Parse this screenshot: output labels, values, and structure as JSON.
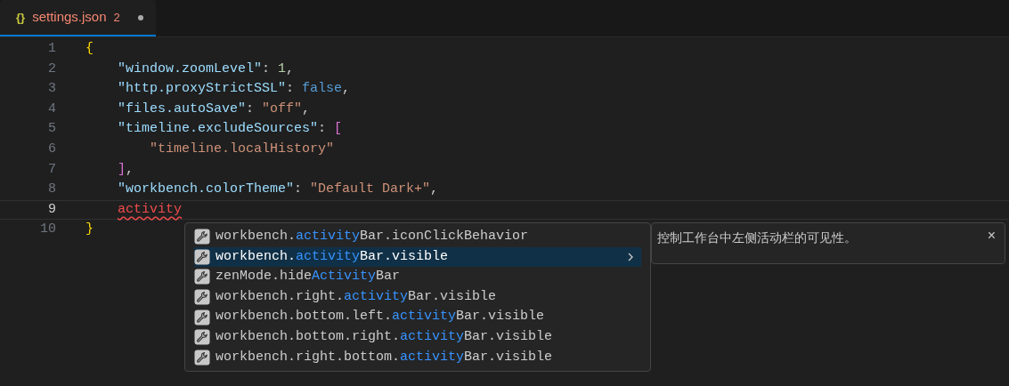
{
  "tab": {
    "icon": "{}",
    "title": "settings.json",
    "problems": "2",
    "dirty": true,
    "selected": true
  },
  "lines": [
    {
      "number": "1",
      "kind": "root",
      "current": false,
      "tokens": [
        {
          "kind": "brace",
          "text": "{"
        }
      ]
    },
    {
      "number": "2",
      "kind": "member",
      "current": false,
      "tokens": [
        {
          "kind": "key",
          "text": "\"window.zoomLevel\""
        },
        {
          "kind": "punct",
          "text": ": "
        },
        {
          "kind": "number",
          "text": "1"
        },
        {
          "kind": "punct",
          "text": ","
        }
      ]
    },
    {
      "number": "3",
      "kind": "member",
      "current": false,
      "tokens": [
        {
          "kind": "key",
          "text": "\"http.proxyStrictSSL\""
        },
        {
          "kind": "punct",
          "text": ": "
        },
        {
          "kind": "bool",
          "text": "false"
        },
        {
          "kind": "punct",
          "text": ","
        }
      ]
    },
    {
      "number": "4",
      "kind": "member",
      "current": false,
      "tokens": [
        {
          "kind": "key",
          "text": "\"files.autoSave\""
        },
        {
          "kind": "punct",
          "text": ": "
        },
        {
          "kind": "string",
          "text": "\"off\""
        },
        {
          "kind": "punct",
          "text": ","
        }
      ]
    },
    {
      "number": "5",
      "kind": "member",
      "current": false,
      "tokens": [
        {
          "kind": "key",
          "text": "\"timeline.excludeSources\""
        },
        {
          "kind": "punct",
          "text": ": "
        },
        {
          "kind": "bracket",
          "text": "["
        }
      ]
    },
    {
      "number": "6",
      "kind": "item",
      "current": false,
      "tokens": [
        {
          "kind": "string",
          "text": "\"timeline.localHistory\""
        }
      ]
    },
    {
      "number": "7",
      "kind": "member",
      "current": false,
      "tokens": [
        {
          "kind": "bracket",
          "text": "]"
        },
        {
          "kind": "punct",
          "text": ","
        }
      ]
    },
    {
      "number": "8",
      "kind": "member",
      "current": false,
      "tokens": [
        {
          "kind": "key",
          "text": "\"workbench.colorTheme\""
        },
        {
          "kind": "punct",
          "text": ": "
        },
        {
          "kind": "string",
          "text": "\"Default Dark+\""
        },
        {
          "kind": "punct",
          "text": ","
        }
      ]
    },
    {
      "number": "9",
      "kind": "member",
      "current": true,
      "tokens": [
        {
          "kind": "error",
          "text": "activity"
        }
      ]
    },
    {
      "number": "10",
      "kind": "root",
      "current": false,
      "tokens": [
        {
          "kind": "brace",
          "text": "}"
        }
      ]
    }
  ],
  "suggestions": [
    {
      "selected": false,
      "parts": [
        {
          "text": "workbench.",
          "match": false
        },
        {
          "text": "activity",
          "match": true
        },
        {
          "text": "Bar.iconClickBehavior",
          "match": false
        }
      ]
    },
    {
      "selected": true,
      "parts": [
        {
          "text": "workbench.",
          "match": false
        },
        {
          "text": "activity",
          "match": true
        },
        {
          "text": "Bar.visible",
          "match": false
        }
      ]
    },
    {
      "selected": false,
      "parts": [
        {
          "text": "zenMode.hide",
          "match": false
        },
        {
          "text": "Activity",
          "match": true
        },
        {
          "text": "Bar",
          "match": false
        }
      ]
    },
    {
      "selected": false,
      "parts": [
        {
          "text": "workbench.right.",
          "match": false
        },
        {
          "text": "activity",
          "match": true
        },
        {
          "text": "Bar.visible",
          "match": false
        }
      ]
    },
    {
      "selected": false,
      "parts": [
        {
          "text": "workbench.bottom.left.",
          "match": false
        },
        {
          "text": "activity",
          "match": true
        },
        {
          "text": "Bar.visible",
          "match": false
        }
      ]
    },
    {
      "selected": false,
      "parts": [
        {
          "text": "workbench.bottom.right.",
          "match": false
        },
        {
          "text": "activity",
          "match": true
        },
        {
          "text": "Bar.visible",
          "match": false
        }
      ]
    },
    {
      "selected": false,
      "parts": [
        {
          "text": "workbench.right.bottom.",
          "match": false
        },
        {
          "text": "activity",
          "match": true
        },
        {
          "text": "Bar.visible",
          "match": false
        }
      ]
    }
  ],
  "details": {
    "text": "控制工作台中左侧活动栏的可见性。",
    "close": "×"
  }
}
